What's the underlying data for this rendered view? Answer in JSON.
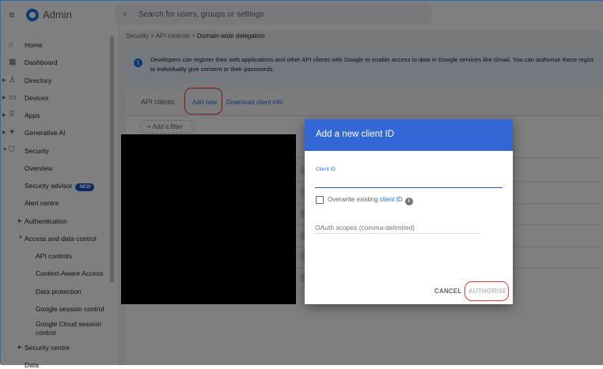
{
  "header": {
    "app_title": "Admin",
    "search_placeholder": "Search for users, groups or settings"
  },
  "sidebar": {
    "items": [
      {
        "label": "Home",
        "icon": "home-icon"
      },
      {
        "label": "Dashboard",
        "icon": "dashboard-icon"
      },
      {
        "label": "Directory",
        "icon": "person-icon"
      },
      {
        "label": "Devices",
        "icon": "devices-icon"
      },
      {
        "label": "Apps",
        "icon": "apps-grid-icon"
      },
      {
        "label": "Generative AI",
        "icon": "sparkle-icon"
      },
      {
        "label": "Security",
        "icon": "shield-icon"
      }
    ],
    "security_sub": [
      "Overview",
      "Security advisor",
      "Alert centre",
      "Authentication",
      "Access and data control",
      "Security centre"
    ],
    "badge": "NEW",
    "access_sub": [
      "API controls",
      "Context-Aware Access",
      "Data protection",
      "Google session control",
      "Google Cloud session control"
    ],
    "last": "Data"
  },
  "breadcrumb": [
    "Security",
    "API controls",
    "Domain-wide delegation"
  ],
  "info_text_1": "Developers can register their web applications and other API clients with Google to enable access to data in Google services like Gmail. You can authorise these regist",
  "info_text_2": "to individually give consent or their passwords.",
  "card": {
    "title": "API clients",
    "add_new": "Add new",
    "download": "Download client info",
    "filter": "Add a filter"
  },
  "modal": {
    "title": "Add a new client ID",
    "client_id_label": "Client ID",
    "client_id_value": "",
    "overwrite_label": "Overwrite existing",
    "overwrite_link": "client ID",
    "overwrite_checked": false,
    "oauth_placeholder": "OAuth scopes (comma-delimited)",
    "cancel": "CANCEL",
    "authorise": "AUTHORISE"
  },
  "colors": {
    "accent": "#1a73e8",
    "modal_header": "#3367d6",
    "highlight": "#e53935"
  }
}
